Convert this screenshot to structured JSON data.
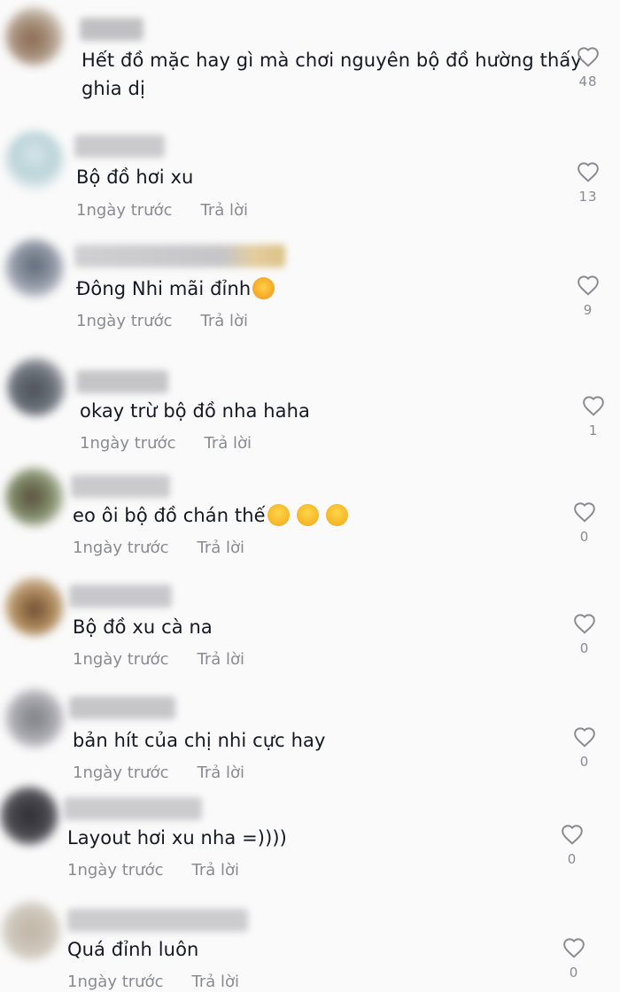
{
  "comments": [
    {
      "text_line1": "Hết đồ mặc hay gì mà chơi nguyên bộ đồ hường thấy",
      "text_line2": "ghia dị",
      "likes": "48"
    },
    {
      "text": "Bộ đồ hơi xu",
      "time": "1ngày trước",
      "reply": "Trả lời",
      "likes": "13"
    },
    {
      "text": "Đông Nhi mãi đỉnh",
      "emoji": "smiling-face-with-hearts",
      "time": "1ngày trước",
      "reply": "Trả lời",
      "likes": "9"
    },
    {
      "text": "okay trừ bộ đồ nha haha",
      "time": "1ngày trước",
      "reply": "Trả lời",
      "likes": "1"
    },
    {
      "text": "eo ôi bộ đồ chán thế",
      "emoji": "face-with-tears-of-joy x3",
      "time": "1ngày trước",
      "reply": "Trả lời",
      "likes": "0"
    },
    {
      "text": "Bộ đồ xu cà na",
      "time": "1ngày trước",
      "reply": "Trả lời",
      "likes": "0"
    },
    {
      "text": "bản hít của chị nhi cực hay",
      "time": "1ngày trước",
      "reply": "Trả lời",
      "likes": "0"
    },
    {
      "text": "Layout hơi xu nha =))))",
      "time": "1ngày trước",
      "reply": "Trả lời",
      "likes": "0"
    },
    {
      "text": "Quá đỉnh luôn",
      "time": "1ngày trước",
      "reply": "Trả lời",
      "likes": "0"
    }
  ],
  "colors": {
    "background": "#fafafa",
    "text": "#161823",
    "meta": "#8a8b91",
    "heart_outline": "#8a8b91"
  },
  "icons": {
    "like": "heart-outline-icon"
  }
}
